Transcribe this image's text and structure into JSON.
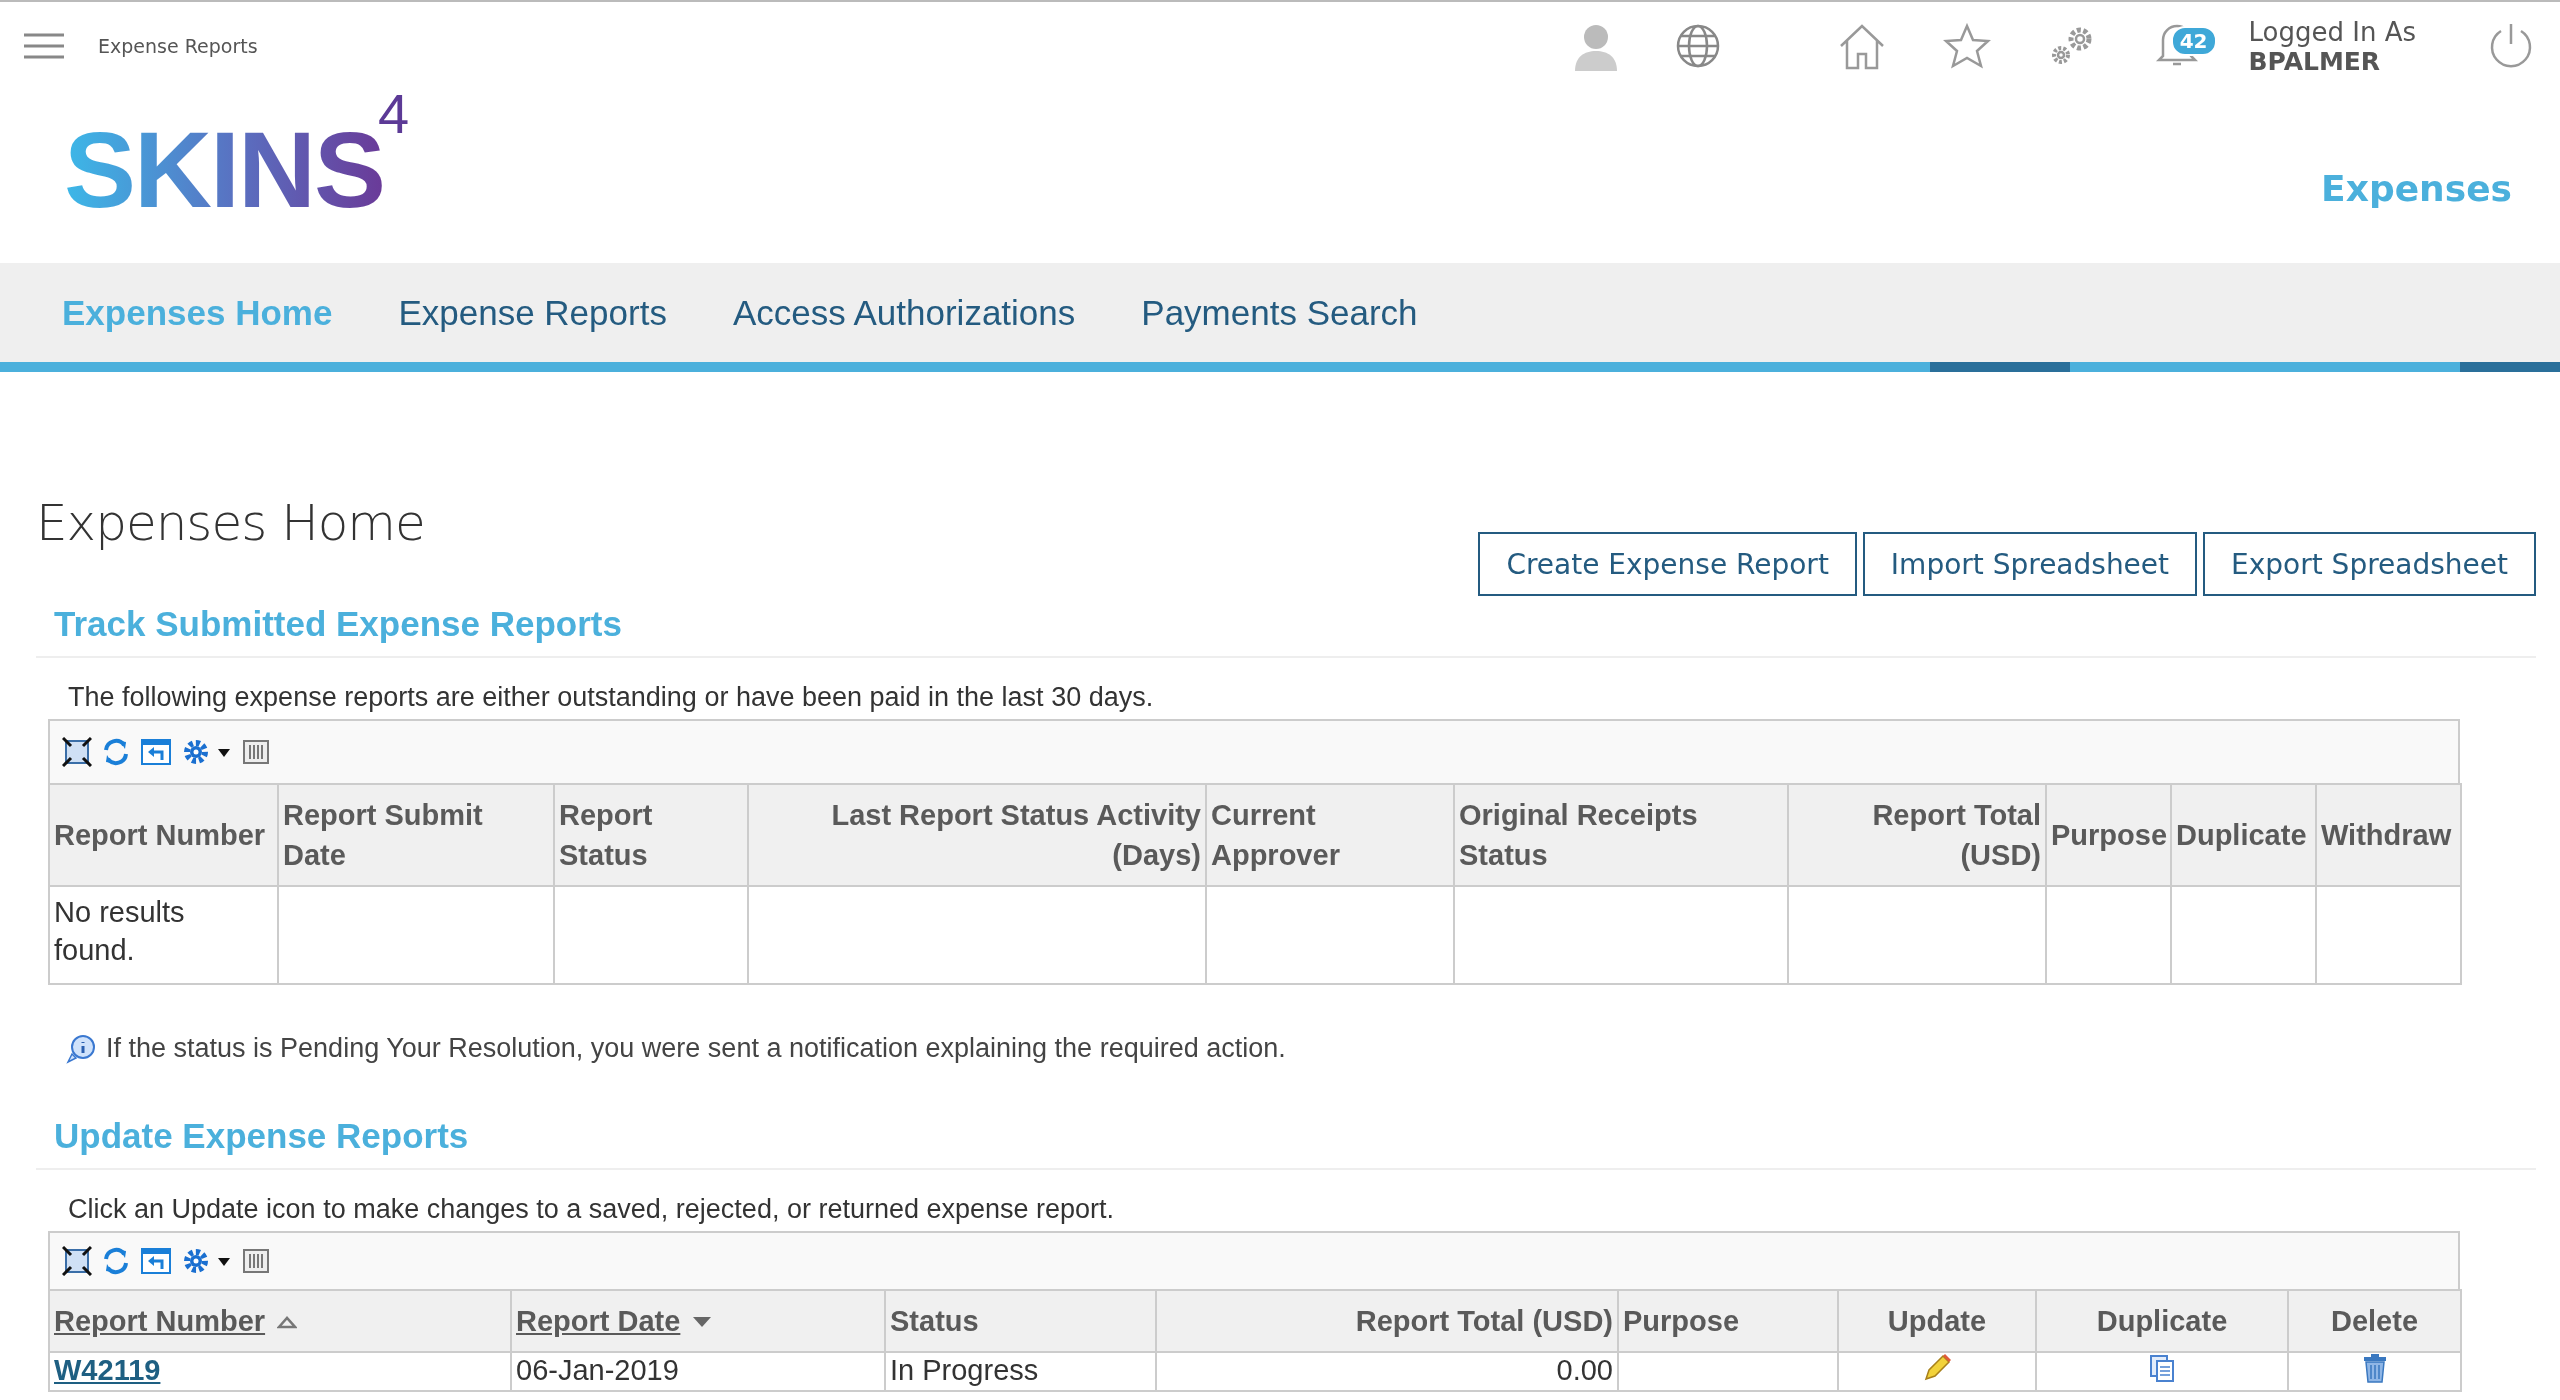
{
  "top_bar": {
    "breadcrumb": "Expense Reports",
    "notifications": "42",
    "login_label": "Logged In As",
    "username": "BPALMER"
  },
  "logo": {
    "text": "SKINS",
    "superscript": "4"
  },
  "app_title": "Expenses",
  "nav": [
    {
      "label": "Expenses Home",
      "selected": true
    },
    {
      "label": "Expense Reports",
      "selected": false
    },
    {
      "label": "Access Authorizations",
      "selected": false
    },
    {
      "label": "Payments Search",
      "selected": false
    }
  ],
  "page_title": "Expenses Home",
  "actions": [
    "Create Expense Report",
    "Import Spreadsheet",
    "Export Spreadsheet"
  ],
  "track_section": {
    "title": "Track Submitted Expense Reports",
    "description": "The following expense reports are either outstanding or have been paid in the last 30 days.",
    "columns": [
      {
        "label": "Report Number"
      },
      {
        "label": "Report Submit Date"
      },
      {
        "label": "Report Status"
      },
      {
        "label": "Last Report Status Activity (Days)"
      },
      {
        "label": "Current Approver"
      },
      {
        "label": "Original Receipts Status"
      },
      {
        "label": "Report Total (USD)"
      },
      {
        "label": "Purpose"
      },
      {
        "label": "Duplicate"
      },
      {
        "label": "Withdraw"
      }
    ],
    "empty_message": "No results found.",
    "note": "If the status is Pending Your Resolution, you were sent a notification explaining the required action."
  },
  "update_section": {
    "title": "Update Expense Reports",
    "description": "Click an Update icon to make changes to a saved, rejected, or returned expense report.",
    "columns": [
      {
        "label": "Report Number",
        "sortable": true,
        "sort_descending": false
      },
      {
        "label": "Report Date",
        "sortable": true,
        "sort_descending": true
      },
      {
        "label": "Status",
        "sortable": false
      },
      {
        "label": "Report Total (USD)",
        "sortable": false
      },
      {
        "label": "Purpose",
        "sortable": false
      },
      {
        "label": "Update",
        "sortable": false
      },
      {
        "label": "Duplicate",
        "sortable": false
      },
      {
        "label": "Delete",
        "sortable": false
      }
    ],
    "rows": [
      {
        "report_number": "W42119",
        "report_date": "06-Jan-2019",
        "status": "In Progress",
        "report_total": "0.00"
      }
    ]
  }
}
